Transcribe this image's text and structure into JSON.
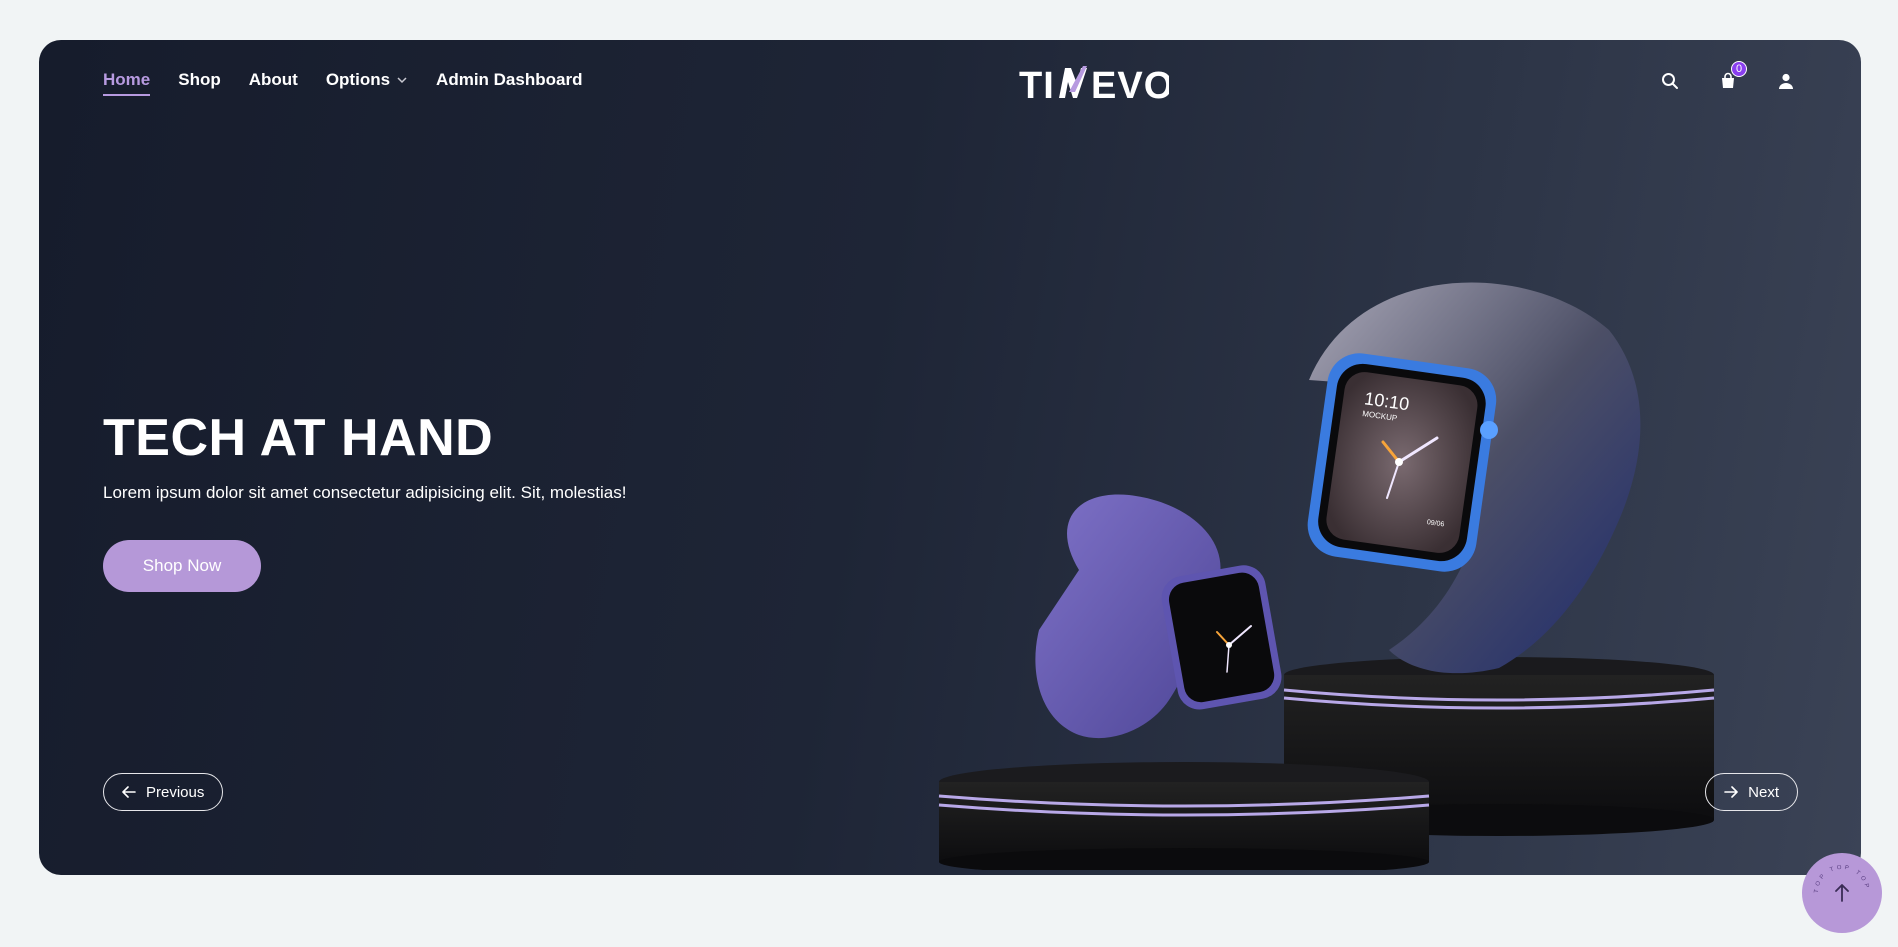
{
  "nav": {
    "items": [
      {
        "label": "Home",
        "active": true
      },
      {
        "label": "Shop",
        "active": false
      },
      {
        "label": "About",
        "active": false
      },
      {
        "label": "Options",
        "active": false,
        "has_dropdown": true
      },
      {
        "label": "Admin Dashboard",
        "active": false
      }
    ]
  },
  "brand": {
    "logo_text": "TIMEVO",
    "accent_color": "#b79ae0"
  },
  "header_icons": {
    "search": "search-icon",
    "cart": "shopping-bag-icon",
    "cart_count": "0",
    "user": "user-icon"
  },
  "hero": {
    "title": "TECH AT HAND",
    "subtitle": "Lorem ipsum dolor sit amet consectetur adipisicing elit. Sit, molestias!",
    "cta_label": "Shop Now",
    "prev_label": "Previous",
    "next_label": "Next",
    "watch_time_label": "10:10",
    "watch_mockup_label": "MOCKUP",
    "watch_date_label": "09/06"
  },
  "colors": {
    "cta": "#b598d8",
    "page_bg": "#f1f4f5",
    "badge": "#8a3ff0"
  },
  "scroll_top": {
    "icon": "arrow-up-icon",
    "ring_text": "TOP TOP TOP"
  }
}
